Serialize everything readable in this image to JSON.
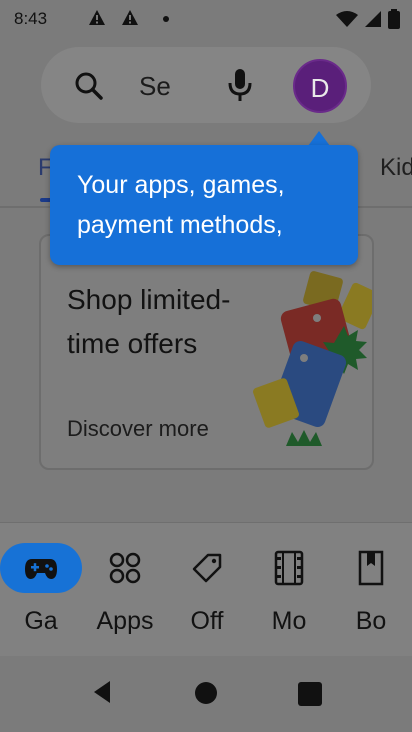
{
  "status_bar": {
    "time": "8:43"
  },
  "search": {
    "placeholder": "Se"
  },
  "account": {
    "avatar_letter": "D"
  },
  "top_tabs": {
    "left_partial": "F",
    "right_partial": "Kid"
  },
  "tooltip": {
    "text": "Your apps, games, payment methods,"
  },
  "promo": {
    "title": "Shop limited-time offers",
    "cta": "Discover more"
  },
  "bottom_nav": [
    {
      "label": "Ga",
      "icon": "gamepad-icon",
      "active": true
    },
    {
      "label": "Apps",
      "icon": "apps-grid-icon",
      "active": false
    },
    {
      "label": "Off",
      "icon": "tag-icon",
      "active": false
    },
    {
      "label": "Mo",
      "icon": "movie-icon",
      "active": false
    },
    {
      "label": "Bo",
      "icon": "book-icon",
      "active": false
    }
  ],
  "colors": {
    "accent": "#1670d8",
    "avatar_bg": "#5a1f7a",
    "scrim": "#7b7b7b"
  }
}
